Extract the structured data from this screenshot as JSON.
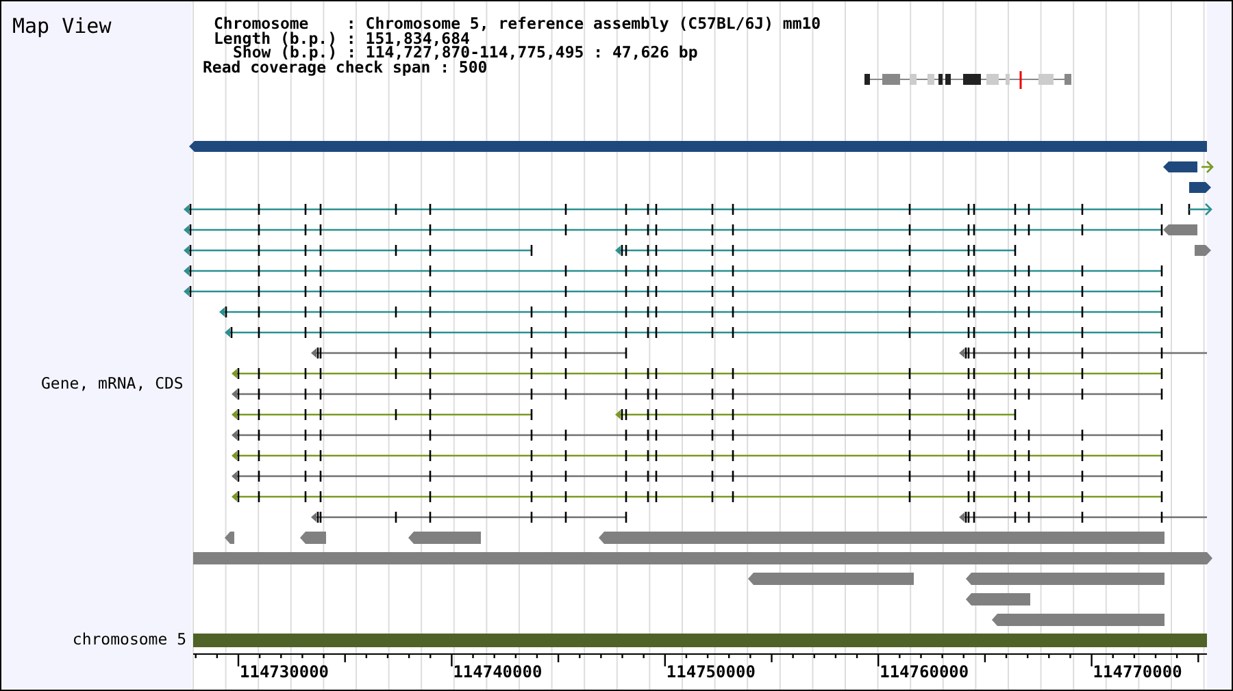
{
  "title": "Map View",
  "header": [
    "Chromosome    : Chromosome 5, reference assembly (C57BL/6J) mm10",
    "Length (b.p.) : 151,834,684",
    "Show (b.p.) : 114,727,870-114,775,495 : 47,626 bp",
    "Read coverage check span : 500"
  ],
  "gene_track": {
    "label": "Gene, mRNA, CDS"
  },
  "chromosome_track": {
    "label": "chromosome 5"
  },
  "axis": {
    "labels": [
      "114730000",
      "114740000",
      "114750000",
      "114760000",
      "114770000"
    ]
  }
}
